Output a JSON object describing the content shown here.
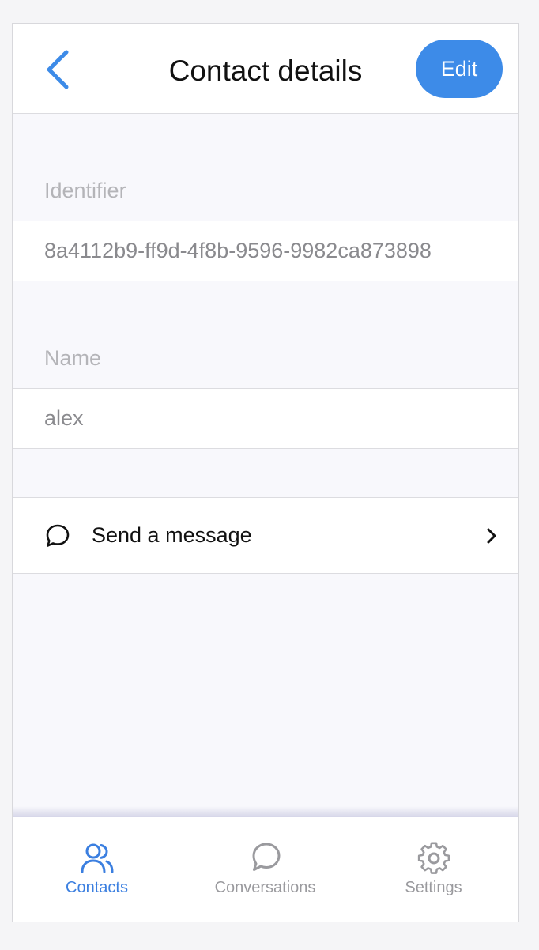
{
  "header": {
    "title": "Contact details",
    "edit_label": "Edit"
  },
  "identifier": {
    "label": "Identifier",
    "value": "8a4112b9-ff9d-4f8b-9596-9982ca873898"
  },
  "name": {
    "label": "Name",
    "value": "alex"
  },
  "action": {
    "label": "Send a message"
  },
  "tabs": [
    {
      "label": "Contacts",
      "icon": "contacts-icon",
      "active": true
    },
    {
      "label": "Conversations",
      "icon": "conversation-icon",
      "active": false
    },
    {
      "label": "Settings",
      "icon": "gear-icon",
      "active": false
    }
  ],
  "colors": {
    "accent": "#3d8be8",
    "tab_active": "#3b7fe0",
    "tab_inactive": "#9a9a9e"
  }
}
